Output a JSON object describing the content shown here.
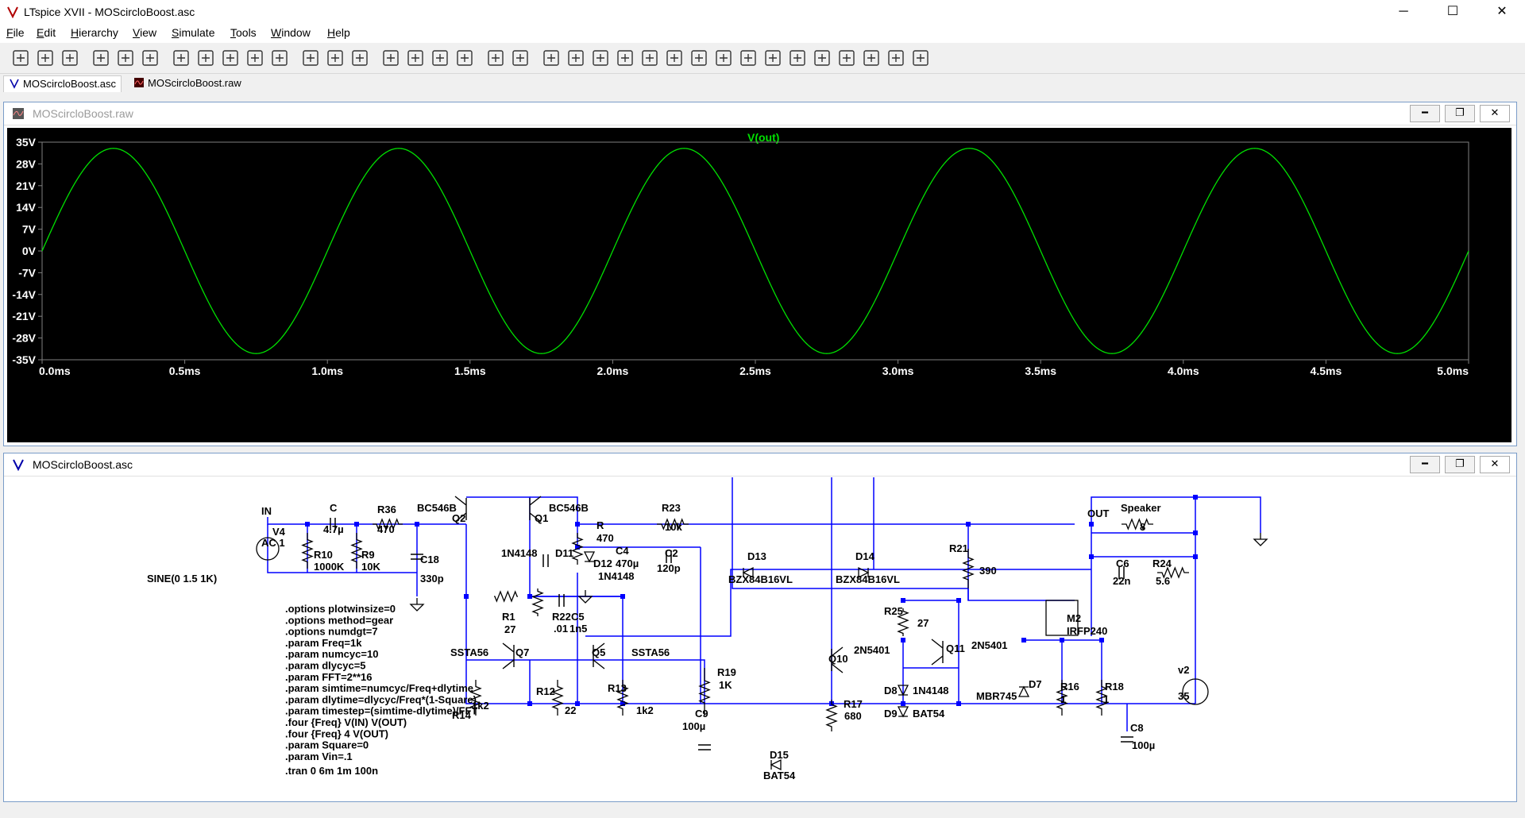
{
  "app": {
    "title": "LTspice XVII - MOScircloBoost.asc"
  },
  "window_buttons": {
    "minimize": "─",
    "maximize": "☐",
    "close": "✕"
  },
  "menu": [
    {
      "label": "File",
      "u": "F",
      "rest": "ile"
    },
    {
      "label": "Edit",
      "u": "E",
      "rest": "dit"
    },
    {
      "label": "Hierarchy",
      "u": "H",
      "rest": "ierarchy"
    },
    {
      "label": "View",
      "u": "V",
      "rest": "iew"
    },
    {
      "label": "Simulate",
      "u": "S",
      "rest": "imulate"
    },
    {
      "label": "Tools",
      "u": "T",
      "rest": "ools"
    },
    {
      "label": "Window",
      "u": "W",
      "rest": "indow"
    },
    {
      "label": "Help",
      "u": "H",
      "rest": "elp"
    }
  ],
  "toolbar_icons": [
    "new-schematic",
    "open",
    "save",
    "control-panel",
    "run",
    "halt",
    "zoom-in",
    "pan",
    "zoom-out",
    "zoom-fit",
    "autorange",
    "tile-horizontal",
    "tile-vertical",
    "cascade",
    "cut",
    "copy",
    "paste",
    "find",
    "print",
    "print-preview",
    "draw-wire",
    "ground",
    "label-net",
    "resistor",
    "capacitor",
    "inductor",
    "diode",
    "component",
    "move",
    "drag",
    "undo",
    "redo",
    "rotate",
    "mirror",
    "text",
    "spice-directive"
  ],
  "tabs": [
    {
      "label": "MOScircloBoost.asc",
      "icon": "schematic-icon",
      "active": true
    },
    {
      "label": "MOScircloBoost.raw",
      "icon": "waveform-icon",
      "active": false
    }
  ],
  "waveform": {
    "window_title": "MOScircloBoost.raw",
    "trace_name": "V(out)",
    "trace_color": "#00e000",
    "plot_background": "#000000",
    "y_ticks": [
      "35V",
      "28V",
      "21V",
      "14V",
      "7V",
      "0V",
      "-7V",
      "-14V",
      "-21V",
      "-28V",
      "-35V"
    ],
    "x_ticks": [
      "0.0ms",
      "0.5ms",
      "1.0ms",
      "1.5ms",
      "2.0ms",
      "2.5ms",
      "3.0ms",
      "3.5ms",
      "4.0ms",
      "4.5ms",
      "5.0ms"
    ]
  },
  "chart_data": {
    "type": "line",
    "title": "V(out)",
    "xlabel": "",
    "ylabel": "",
    "xlim": [
      0,
      5.0
    ],
    "x_unit": "ms",
    "ylim": [
      -35,
      35
    ],
    "y_unit": "V",
    "grid": false,
    "series": [
      {
        "name": "V(out)",
        "function": "sine",
        "amplitude": 33,
        "frequency_khz": 1,
        "phase_deg": 0,
        "x": [
          0,
          0.25,
          0.5,
          0.75,
          1.0,
          1.25,
          1.5,
          1.75,
          2.0,
          2.25,
          2.5,
          2.75,
          3.0,
          3.25,
          3.5,
          3.75,
          4.0,
          4.25,
          4.5,
          4.75,
          5.0
        ],
        "values": [
          0,
          33,
          0,
          -33,
          0,
          33,
          0,
          -33,
          0,
          33,
          0,
          -33,
          0,
          33,
          0,
          -33,
          0,
          33,
          0,
          -33,
          0
        ]
      }
    ]
  },
  "schematic": {
    "window_title": "MOScircloBoost.asc",
    "wire_color": "#0000ff",
    "labels": [
      "IN",
      "V4",
      "AC 1",
      "C",
      "4.7µ",
      "R36",
      "470",
      "BC546B",
      "Q2",
      "C18",
      "330p",
      "R10",
      "1000K",
      "R9",
      "10K",
      "Q1",
      "BC546B",
      "R",
      "470",
      "C4",
      "470µ",
      "1N4148",
      "D11",
      "D12",
      "1N4148",
      "R23",
      "10k",
      "C2",
      "120p",
      "D13",
      "BZX84B16VL",
      "D14",
      "BZX84B16VL",
      "R21",
      "390",
      "OUT",
      "Speaker",
      "8",
      "C6",
      "22n",
      "R24",
      "5.6",
      "M2",
      "IRFP240",
      "R22",
      ".01",
      "C5",
      "1n5",
      "R1",
      "27",
      "SSTA56",
      "Q7",
      "Q5",
      "SSTA56",
      "R12",
      "22",
      "R13",
      "1k2",
      "R14",
      "1k2",
      "R19",
      "1K",
      "C9",
      "100µ",
      "D15",
      "BAT54",
      "Q10",
      "2N5401",
      "R17",
      "680",
      "R25",
      "27",
      "Q11",
      "2N5401",
      "D8",
      "1N4148",
      "D9",
      "BAT54",
      "D7",
      "MBR745",
      "R16",
      "1",
      "R18",
      "1",
      "v2",
      "35",
      "C8",
      "100µ",
      "SINE(0 1.5 1K)"
    ],
    "directives": [
      ".options plotwinsize=0",
      ".options method=gear",
      ".options numdgt=7",
      ".param Freq=1k",
      ".param numcyc=10",
      ".param dlycyc=5",
      ".param FFT=2**16",
      ".param simtime=numcyc/Freq+dlytime",
      ".param dlytime=dlycyc/Freq*(1-Square)",
      ".param timestep=(simtime-dlytime)/FFT",
      ".four {Freq}  V(IN) V(OUT)",
      ".four {Freq} 4 V(OUT)",
      ".param Square=0",
      ".param Vin=.1"
    ],
    "tran": ".tran 0 6m 1m 100n"
  }
}
